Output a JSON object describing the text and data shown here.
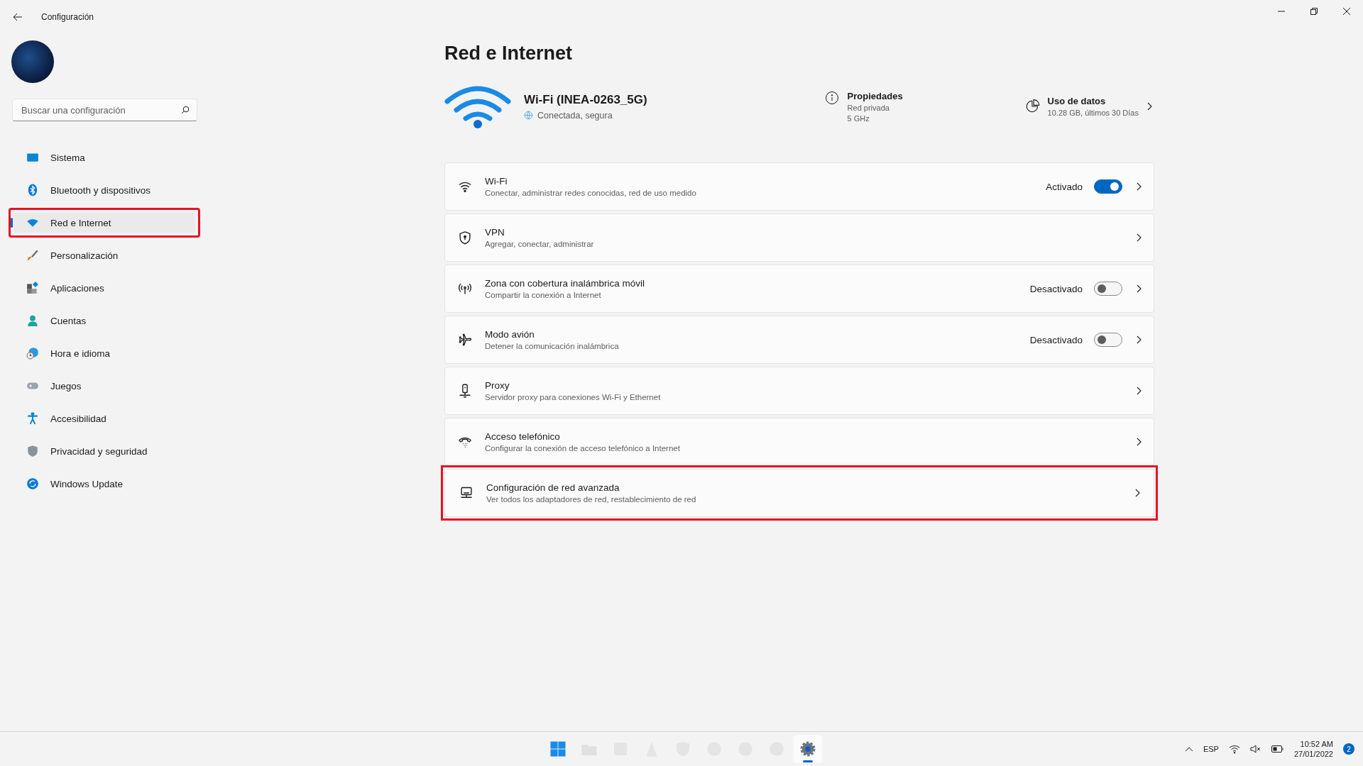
{
  "window": {
    "title": "Configuración"
  },
  "sidebar": {
    "search": {
      "placeholder": "Buscar una configuración"
    },
    "items": [
      {
        "label": "Sistema",
        "selected": false,
        "highlighted": false
      },
      {
        "label": "Bluetooth y dispositivos",
        "selected": false,
        "highlighted": false
      },
      {
        "label": "Red e Internet",
        "selected": true,
        "highlighted": true
      },
      {
        "label": "Personalización",
        "selected": false,
        "highlighted": false
      },
      {
        "label": "Aplicaciones",
        "selected": false,
        "highlighted": false
      },
      {
        "label": "Cuentas",
        "selected": false,
        "highlighted": false
      },
      {
        "label": "Hora e idioma",
        "selected": false,
        "highlighted": false
      },
      {
        "label": "Juegos",
        "selected": false,
        "highlighted": false
      },
      {
        "label": "Accesibilidad",
        "selected": false,
        "highlighted": false
      },
      {
        "label": "Privacidad y seguridad",
        "selected": false,
        "highlighted": false
      },
      {
        "label": "Windows Update",
        "selected": false,
        "highlighted": false
      }
    ]
  },
  "page": {
    "title": "Red e Internet",
    "connection": {
      "name": "Wi-Fi (INEA-0263_5G)",
      "status": "Conectada, segura"
    },
    "properties": {
      "title": "Propiedades",
      "lines": [
        "Red privada",
        "5 GHz"
      ]
    },
    "data_usage": {
      "title": "Uso de datos",
      "detail": "10.28 GB, últimos 30 Días"
    },
    "cards": [
      {
        "title": "Wi-Fi",
        "subtitle": "Conectar, administrar redes conocidas, red de uso medido",
        "kind": "toggle",
        "state": "Activado",
        "on": true,
        "highlighted": false
      },
      {
        "title": "VPN",
        "subtitle": "Agregar, conectar, administrar",
        "kind": "link",
        "highlighted": false
      },
      {
        "title": "Zona con cobertura inalámbrica móvil",
        "subtitle": "Compartir la conexión a Internet",
        "kind": "toggle",
        "state": "Desactivado",
        "on": false,
        "highlighted": false
      },
      {
        "title": "Modo avión",
        "subtitle": "Detener la comunicación inalámbrica",
        "kind": "toggle",
        "state": "Desactivado",
        "on": false,
        "highlighted": false
      },
      {
        "title": "Proxy",
        "subtitle": "Servidor proxy para conexiones Wi-Fi y Ethernet",
        "kind": "link",
        "highlighted": false
      },
      {
        "title": "Acceso telefónico",
        "subtitle": "Configurar la conexión de acceso telefónico a Internet",
        "kind": "link",
        "highlighted": false
      },
      {
        "title": "Configuración de red avanzada",
        "subtitle": "Ver todos los adaptadores de red, restablecimiento de red",
        "kind": "link",
        "highlighted": true
      }
    ]
  },
  "taskbar": {
    "apps": [
      {
        "selected": false
      },
      {
        "selected": false
      },
      {
        "selected": false
      },
      {
        "selected": false
      },
      {
        "selected": false
      },
      {
        "selected": false
      },
      {
        "selected": false
      },
      {
        "selected": false
      },
      {
        "selected": true
      }
    ],
    "language": "ESP",
    "time": "10:52 AM",
    "date": "27/01/2022",
    "notifications": "2"
  }
}
